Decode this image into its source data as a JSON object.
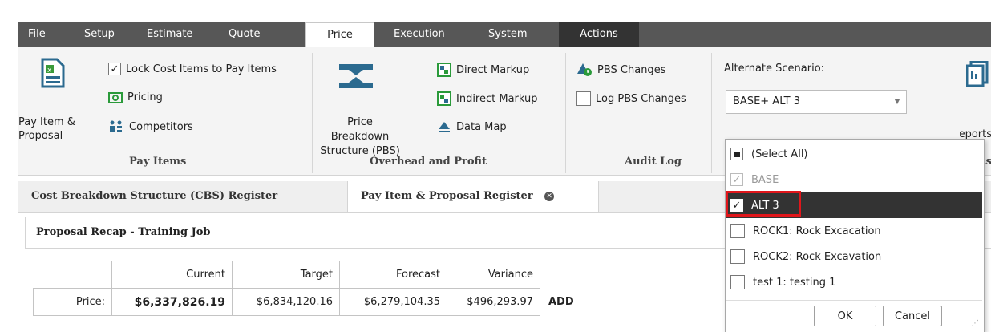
{
  "menu": {
    "tabs": [
      "File",
      "Setup",
      "Estimate",
      "Quote",
      "Price",
      "Execution",
      "System",
      "Actions"
    ]
  },
  "ribbon": {
    "pay_items": {
      "big_button": "Pay Item & Proposal",
      "lock_label": "Lock Cost Items to Pay Items",
      "lock_checked": true,
      "pricing_label": "Pricing",
      "competitors_label": "Competitors",
      "group_label": "Pay Items"
    },
    "overhead": {
      "big_button": "Price Breakdown Structure (PBS)",
      "direct_markup": "Direct Markup",
      "indirect_markup": "Indirect Markup",
      "data_map": "Data Map",
      "group_label": "Overhead and Profit"
    },
    "audit": {
      "pbs_changes": "PBS Changes",
      "log_pbs_changes": "Log PBS Changes",
      "log_checked": false,
      "group_label": "Audit Log"
    },
    "scenario": {
      "label": "Alternate Scenario:",
      "value": "BASE+ ALT 3"
    },
    "reports": {
      "label_partial": "Reports",
      "group_partial": "Reports"
    }
  },
  "doc_tabs": [
    {
      "label": "Cost Breakdown Structure (CBS) Register"
    },
    {
      "label": "Pay Item & Proposal Register"
    }
  ],
  "recap": {
    "title": "Proposal Recap - Training Job",
    "headers": [
      "Current",
      "Target",
      "Forecast",
      "Variance"
    ],
    "row_label": "Price:",
    "row": [
      "$6,337,826.19",
      "$6,834,120.16",
      "$6,279,104.35",
      "$496,293.97"
    ],
    "trailing": "ADD"
  },
  "dropdown": {
    "items": [
      {
        "label": "(Select All)",
        "state": "partial"
      },
      {
        "label": "BASE",
        "state": "checked-disabled"
      },
      {
        "label": "ALT 3",
        "state": "checked"
      },
      {
        "label": "ROCK1: Rock Excacation",
        "state": "unchecked"
      },
      {
        "label": "ROCK2: Rock Excavation",
        "state": "unchecked"
      },
      {
        "label": "test 1: testing 1",
        "state": "unchecked"
      }
    ],
    "ok_label": "OK",
    "cancel_label": "Cancel",
    "highlight_color": "#e0161b"
  }
}
